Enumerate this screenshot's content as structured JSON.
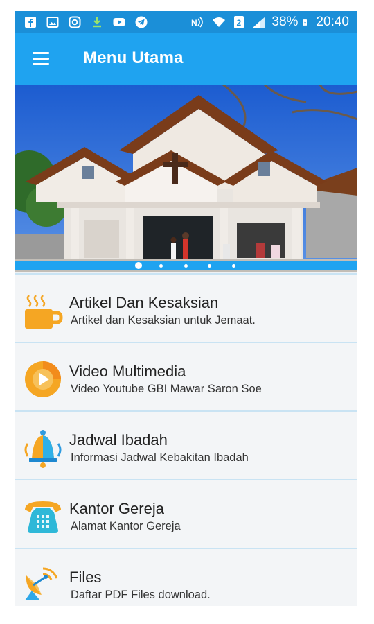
{
  "status_bar": {
    "battery": "38%",
    "time": "20:40",
    "left_icons": [
      "facebook-icon",
      "gallery-icon",
      "instagram-icon",
      "download-icon",
      "youtube-icon",
      "telegram-icon"
    ],
    "right_icons": [
      "nfc-icon",
      "wifi-icon",
      "sim-icon",
      "signal-icon",
      "battery-icon"
    ]
  },
  "app_bar": {
    "title": "Menu Utama",
    "menu_icon": "hamburger-icon",
    "color": "#1fa3f0"
  },
  "banner": {
    "image": "church-photo",
    "slides": 5,
    "active_slide": 1
  },
  "menu": [
    {
      "icon": "coffee-cup-icon",
      "title": "Artikel Dan Kesaksian",
      "subtitle": "Artikel dan Kesaksian untuk Jemaat."
    },
    {
      "icon": "video-play-icon",
      "title": "Video Multimedia",
      "subtitle": "Video Youtube GBI Mawar Saron Soe"
    },
    {
      "icon": "bell-icon",
      "title": "Jadwal Ibadah",
      "subtitle": "Informasi Jadwal Kebakitan Ibadah"
    },
    {
      "icon": "telephone-icon",
      "title": "Kantor Gereja",
      "subtitle": "Alamat Kantor Gereja"
    },
    {
      "icon": "satellite-dish-icon",
      "title": "Files",
      "subtitle": "Daftar PDF Files download."
    }
  ]
}
